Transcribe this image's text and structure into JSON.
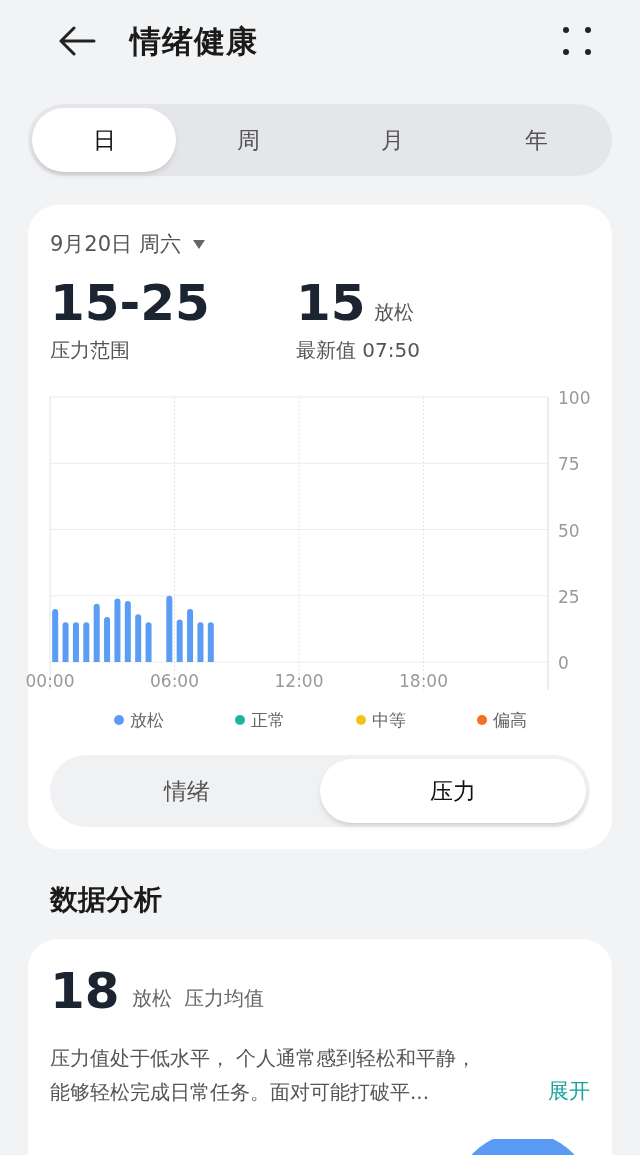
{
  "header": {
    "title": "情绪健康"
  },
  "period_tabs": [
    {
      "label": "日",
      "selected": true
    },
    {
      "label": "周",
      "selected": false
    },
    {
      "label": "月",
      "selected": false
    },
    {
      "label": "年",
      "selected": false
    }
  ],
  "summary_card": {
    "date": "9月20日 周六",
    "range": {
      "value": "15-25",
      "label": "压力范围"
    },
    "latest": {
      "value": "15",
      "level_text": "放松",
      "label": "最新值 07:50"
    },
    "chart_data": {
      "type": "bar",
      "x": [
        0.25,
        0.75,
        1.25,
        1.75,
        2.25,
        2.75,
        3.25,
        3.75,
        4.25,
        4.75,
        5.75,
        6.25,
        6.75,
        7.25,
        7.75
      ],
      "series": [
        {
          "color": "#5b9cf5",
          "values": [
            20,
            15,
            15,
            15,
            22,
            17,
            24,
            23,
            18,
            15,
            25,
            16,
            20,
            15,
            15
          ]
        }
      ],
      "grid": true,
      "xlim": [
        0,
        24
      ],
      "ylim": [
        0,
        100
      ],
      "xticks": [
        {
          "value": 0,
          "label": "00:00"
        },
        {
          "value": 6,
          "label": "06:00"
        },
        {
          "value": 12,
          "label": "12:00"
        },
        {
          "value": 18,
          "label": "18:00"
        }
      ],
      "yticks": [
        0,
        25,
        50,
        75,
        100
      ]
    },
    "legend": [
      {
        "label": "放松",
        "color": "#5b9cf5"
      },
      {
        "label": "正常",
        "color": "#1cb5a3"
      },
      {
        "label": "中等",
        "color": "#f5c21b"
      },
      {
        "label": "偏高",
        "color": "#f2711c"
      }
    ],
    "mode_tabs": [
      {
        "label": "情绪",
        "selected": false
      },
      {
        "label": "压力",
        "selected": true
      }
    ]
  },
  "analysis": {
    "heading": "数据分析",
    "value": "18",
    "level_text": "放松",
    "label": "压力均值",
    "text_lines": [
      "压力值处于低水平， 个人通常感到轻松和平静，",
      "能够轻松完成日常任务。面对可能打破平..."
    ],
    "expand": "展开"
  }
}
